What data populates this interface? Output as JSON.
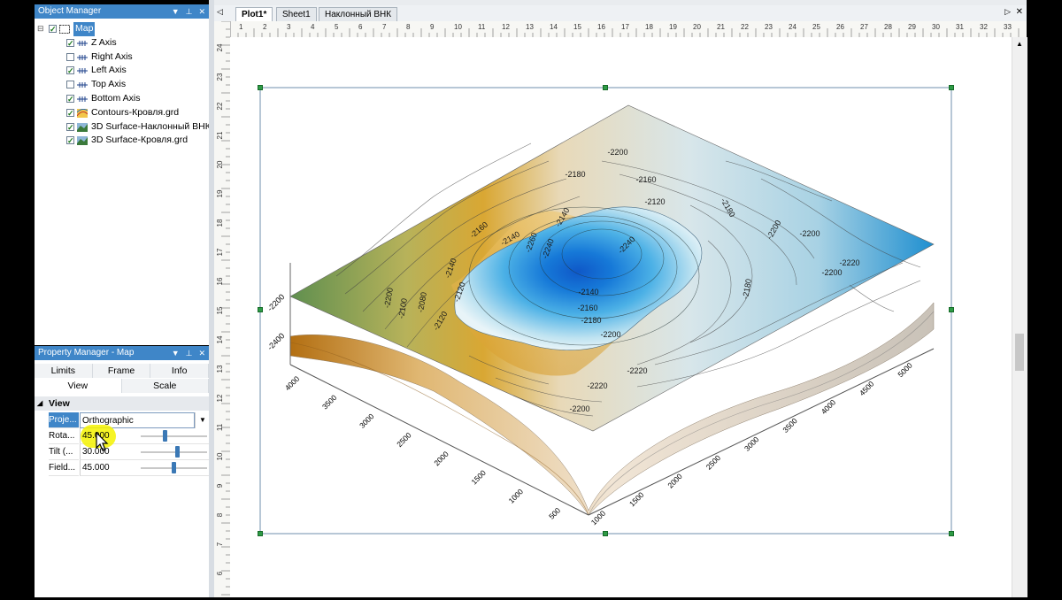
{
  "object_manager": {
    "title": "Object Manager",
    "items": [
      {
        "label": "Map",
        "checked": true,
        "selected": true,
        "icon": "map-frame-icon"
      },
      {
        "label": "Z Axis",
        "checked": true,
        "icon": "axis-icon"
      },
      {
        "label": "Right Axis",
        "checked": false,
        "icon": "axis-icon"
      },
      {
        "label": "Left Axis",
        "checked": true,
        "icon": "axis-icon"
      },
      {
        "label": "Top Axis",
        "checked": false,
        "icon": "axis-icon"
      },
      {
        "label": "Bottom Axis",
        "checked": true,
        "icon": "axis-icon"
      },
      {
        "label": "Contours-Кровля.grd",
        "checked": true,
        "icon": "contours-icon"
      },
      {
        "label": "3D Surface-Наклонный ВНК",
        "checked": true,
        "icon": "surface-icon"
      },
      {
        "label": "3D Surface-Кровля.grd",
        "checked": true,
        "icon": "surface-icon"
      }
    ]
  },
  "property_manager": {
    "title": "Property Manager - Map",
    "tabs_row1": [
      "Limits",
      "Frame",
      "Info"
    ],
    "tabs_row2": [
      "View",
      "Scale"
    ],
    "active_tab": "View",
    "section": "View",
    "properties": [
      {
        "name": "Proje...",
        "value": "Orthographic",
        "type": "dropdown"
      },
      {
        "name": "Rota...",
        "value": "45.000",
        "slider": 0.35,
        "highlighted": true
      },
      {
        "name": "Tilt (...",
        "value": "30.000",
        "slider": 0.55
      },
      {
        "name": "Field...",
        "value": "45.000",
        "slider": 0.5
      }
    ]
  },
  "doc_tabs": [
    "Plot1*",
    "Sheet1",
    "Наклонный ВНК"
  ],
  "active_doc_tab": "Plot1*",
  "ruler": {
    "horizontal": [
      "1",
      "2",
      "3",
      "4",
      "5",
      "6",
      "7",
      "8",
      "9",
      "10",
      "11",
      "12",
      "13",
      "14",
      "15",
      "16",
      "17",
      "18",
      "19",
      "20",
      "21",
      "22",
      "23",
      "24",
      "25",
      "26",
      "27",
      "28",
      "29",
      "30",
      "31",
      "32",
      "33"
    ],
    "vertical": [
      "24",
      "23",
      "22",
      "21",
      "20",
      "19",
      "18",
      "17",
      "16",
      "15",
      "14",
      "13",
      "12",
      "11",
      "10",
      "9",
      "8",
      "7",
      "6"
    ]
  },
  "plot": {
    "z_labels": [
      "-2200",
      "-2400"
    ],
    "left_axis_ticks": [
      "4000",
      "3500",
      "3000",
      "2500",
      "2000",
      "1500",
      "1000",
      "500"
    ],
    "right_axis_ticks": [
      "1000",
      "1500",
      "2000",
      "2500",
      "3000",
      "3500",
      "4000",
      "4500",
      "5000"
    ],
    "contour_labels": [
      "-2200",
      "-2180",
      "-2160",
      "-2120",
      "-2140",
      "-2140",
      "-2160",
      "-2180",
      "-2200",
      "-2200",
      "-2240",
      "-2220",
      "-2200",
      "-2180",
      "-2140",
      "-2120",
      "-2080",
      "-2100",
      "-2120",
      "-2140",
      "-2160",
      "-2180",
      "-2200",
      "-2220",
      "-2220",
      "-2200",
      "-2240",
      "-2260",
      "-2200"
    ]
  },
  "colors": {
    "accent": "#3f86c8",
    "selection_handles": "#2e9b45",
    "highlight": "#f5f200"
  }
}
